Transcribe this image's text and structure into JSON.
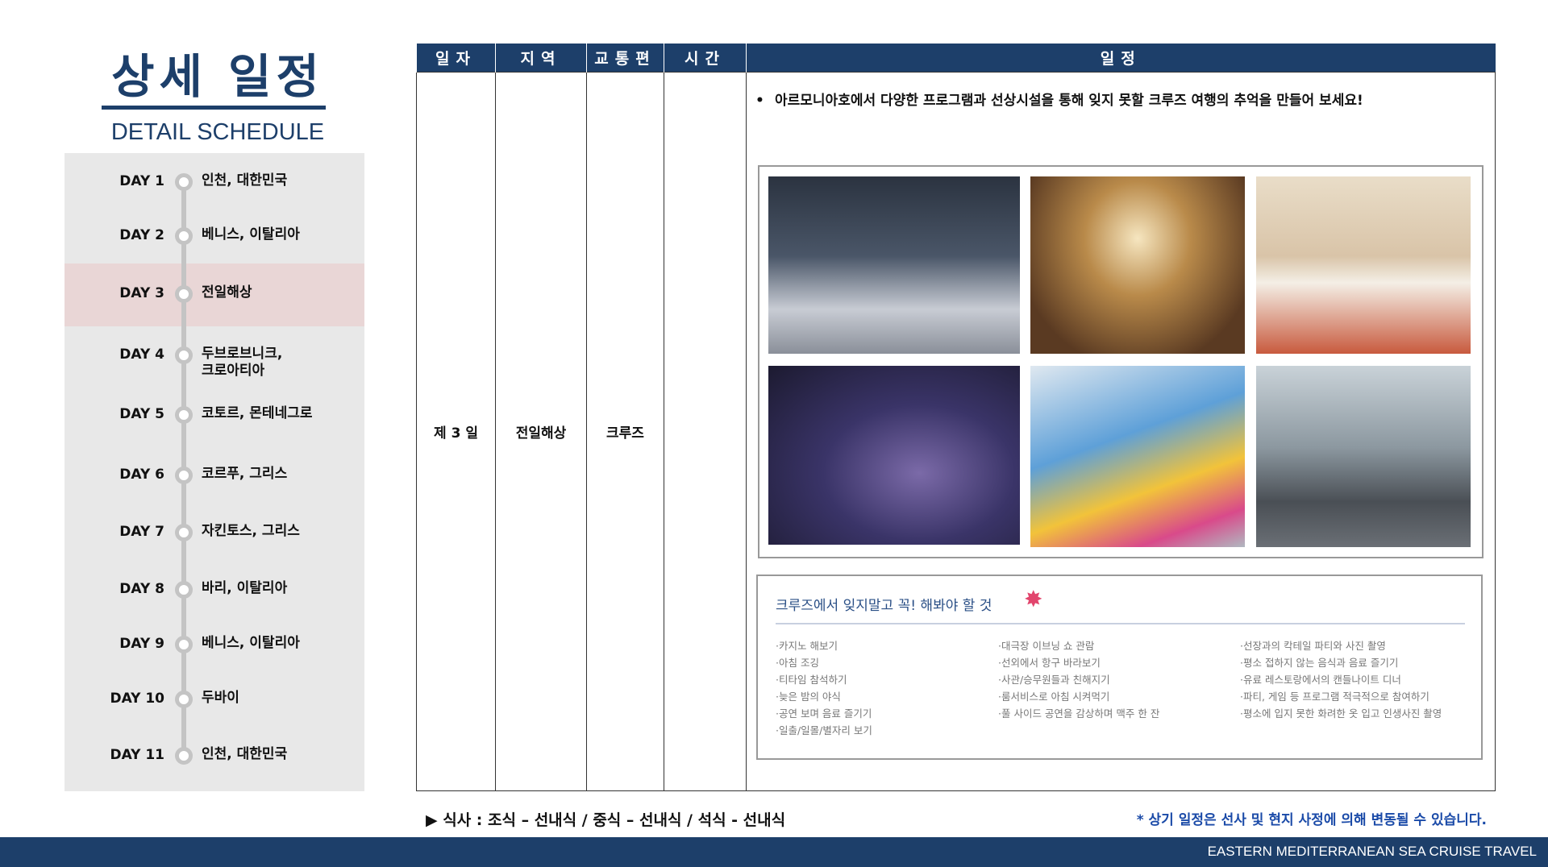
{
  "header": {
    "title": "상세 일정",
    "subtitle": "DETAIL SCHEDULE"
  },
  "sidebar": {
    "days": [
      {
        "day": "DAY 1",
        "place": "인천, 대한민국"
      },
      {
        "day": "DAY 2",
        "place": "베니스, 이탈리아"
      },
      {
        "day": "DAY 3",
        "place": "전일해상",
        "active": true
      },
      {
        "day": "DAY 4",
        "place": "두브로브니크,\n크로아티아"
      },
      {
        "day": "DAY 5",
        "place": "코토르, 몬테네그로"
      },
      {
        "day": "DAY 6",
        "place": "코르푸, 그리스"
      },
      {
        "day": "DAY 7",
        "place": "자킨토스, 그리스"
      },
      {
        "day": "DAY 8",
        "place": "바리, 이탈리아"
      },
      {
        "day": "DAY 9",
        "place": "베니스, 이탈리아"
      },
      {
        "day": "DAY 10",
        "place": "두바이"
      },
      {
        "day": "DAY 11",
        "place": "인천, 대한민국"
      }
    ]
  },
  "table": {
    "headers": [
      "일자",
      "지역",
      "교통편",
      "시간",
      "일정"
    ],
    "row": {
      "date": "제 3 일",
      "region": "전일해상",
      "transport": "크루즈",
      "time": ""
    },
    "description": "아르모니아호에서 다양한 프로그램과 선상시설을 통해 잊지 못할 크루즈 여행의 추억을 만들어 보세요!"
  },
  "must_do": {
    "title": "크루즈에서 잊지말고 꼭! 해봐야 할 것",
    "columns": [
      [
        "·카지노 해보기",
        "·아침 조깅",
        "·티타임 참석하기",
        "·늦은 밤의 야식",
        "·공연 보며 음료 즐기기",
        "·일출/일몰/별자리 보기"
      ],
      [
        "·대극장 이브닝 쇼 관람",
        "·선외에서 항구 바라보기",
        "·사관/승무원들과 친해지기",
        "·룸서비스로 아침 시켜먹기",
        "·풀 사이드 공연을 감상하며 맥주 한 잔"
      ],
      [
        "·선장과의 칵테일 파티와 사진 촬영",
        "·평소 접하지 않는 음식과 음료 즐기기",
        "·유료 레스토랑에서의 캔들나이트 디너",
        "·파티, 게임 등 프로그램 적극적으로 참여하기",
        "·평소에 입지 못한 화려한 옷 입고 인생사진 촬영"
      ]
    ]
  },
  "meal": "▶ 식사 : 조식 – 선내식 / 중식 – 선내식 / 석식 - 선내식",
  "notice": "* 상기 일정은 선사 및 현지 사정에 의해 변동될 수 있습니다.",
  "footer": "EASTERN MEDITERRANEAN SEA CRUISE TRAVEL"
}
